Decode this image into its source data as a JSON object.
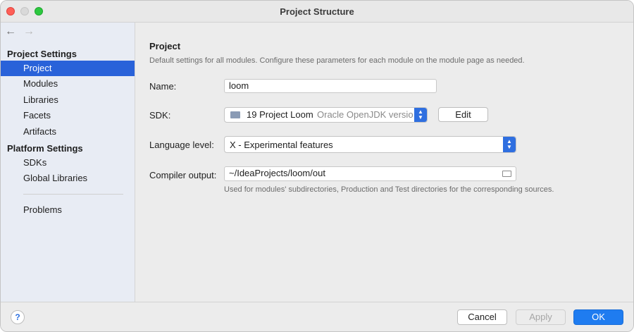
{
  "window": {
    "title": "Project Structure"
  },
  "nav": {
    "back_icon": "arrow-left-icon",
    "forward_icon": "arrow-right-icon"
  },
  "sidebar": {
    "project_settings_title": "Project Settings",
    "project_items": [
      "Project",
      "Modules",
      "Libraries",
      "Facets",
      "Artifacts"
    ],
    "platform_settings_title": "Platform Settings",
    "platform_items": [
      "SDKs",
      "Global Libraries"
    ],
    "other_items": [
      "Problems"
    ],
    "selected": "Project"
  },
  "main": {
    "title": "Project",
    "description": "Default settings for all modules. Configure these parameters for each module on the module page as needed.",
    "name_label": "Name:",
    "name_value": "loom",
    "sdk_label": "SDK:",
    "sdk_value": "19 Project Loom",
    "sdk_detail": "Oracle OpenJDK versio",
    "sdk_icon": "folder-icon",
    "edit_label": "Edit",
    "language_level_label": "Language level:",
    "language_level_value": "X - Experimental features",
    "compiler_output_label": "Compiler output:",
    "compiler_output_value": "~/IdeaProjects/loom/out",
    "compiler_output_hint": "Used for modules' subdirectories, Production and Test directories for the corresponding sources."
  },
  "footer": {
    "help_label": "?",
    "cancel_label": "Cancel",
    "apply_label": "Apply",
    "ok_label": "OK"
  },
  "colors": {
    "accent": "#2962d9",
    "primary_button": "#1f7cf0"
  }
}
